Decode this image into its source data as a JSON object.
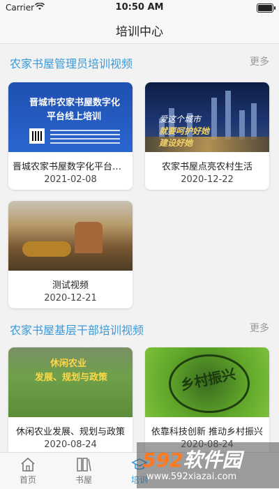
{
  "status": {
    "carrier": "Carrier",
    "time": "10:50 AM"
  },
  "nav": {
    "title": "培训中心"
  },
  "sections": [
    {
      "title": "农家书屋管理员培训视频",
      "more": "更多",
      "items": [
        {
          "title": "晋城农家书屋数字化平台线上...",
          "date": "2021-02-08",
          "thumb_text": [
            "晋城市农家书屋数字化",
            "平台线上培训"
          ]
        },
        {
          "title": "农家书屋点亮农村生活",
          "date": "2020-12-22",
          "thumb_text": [
            "爱这个城市",
            "就要呵护好她",
            "建设好她"
          ]
        },
        {
          "title": "测试视频",
          "date": "2020-12-21"
        }
      ]
    },
    {
      "title": "农家书屋基层干部培训视频",
      "more": "更多",
      "items": [
        {
          "title": "休闲农业发展、规划与政策",
          "date": "2020-08-24",
          "thumb_text": [
            "休闲农业",
            "发展、规划与政策"
          ]
        },
        {
          "title": "依靠科技创新 推动乡村振兴",
          "date": "2020-08-24",
          "thumb_text": [
            "乡村振兴"
          ]
        }
      ]
    }
  ],
  "tabs": [
    {
      "label": "首页",
      "icon": "home-icon"
    },
    {
      "label": "书屋",
      "icon": "bookshelf-icon"
    },
    {
      "label": "培训",
      "icon": "training-icon",
      "active": true
    }
  ],
  "watermark": {
    "logo_num": "592",
    "logo_text": "软件园",
    "url": "www.592xiazai.com"
  },
  "colors": {
    "accent": "#3a9ad9",
    "more": "#999999",
    "background": "#f2f2f2"
  }
}
